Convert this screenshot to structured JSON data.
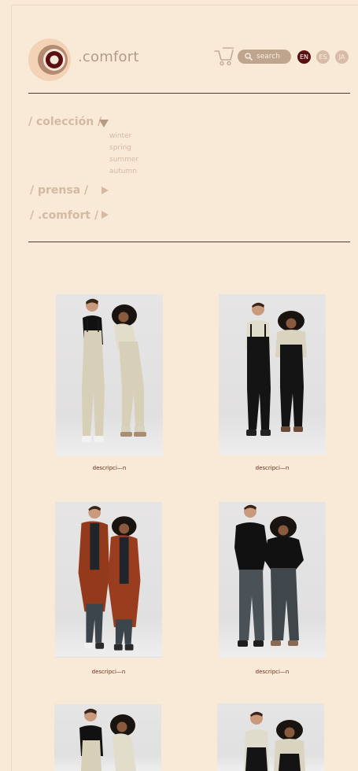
{
  "header": {
    "brand": ".comfort",
    "search_label": "search",
    "languages": [
      {
        "code": "EN",
        "active": true
      },
      {
        "code": "ES",
        "active": false
      },
      {
        "code": "JA",
        "active": false
      }
    ]
  },
  "nav": {
    "coleccion": {
      "label": "/ colección /",
      "expanded": true,
      "subitems": [
        "winter",
        "spring",
        "summer",
        "autumn"
      ]
    },
    "prensa": {
      "label": "/ prensa /",
      "expanded": false
    },
    "comfort": {
      "label": "/ .comfort /",
      "expanded": false
    }
  },
  "products": [
    {
      "caption": "descripci—n",
      "outfit": "beige overalls"
    },
    {
      "caption": "descripci—n",
      "outfit": "black overalls"
    },
    {
      "caption": "descripci—n",
      "outfit": "rust long coats"
    },
    {
      "caption": "descripci—n",
      "outfit": "black tees grey trousers"
    },
    {
      "caption": "",
      "outfit": "beige overalls"
    },
    {
      "caption": "",
      "outfit": "black overalls"
    }
  ],
  "colors": {
    "background": "#f8ead6",
    "accent": "#5a1010",
    "muted": "#d5b9a3",
    "button": "#bfa48e"
  }
}
